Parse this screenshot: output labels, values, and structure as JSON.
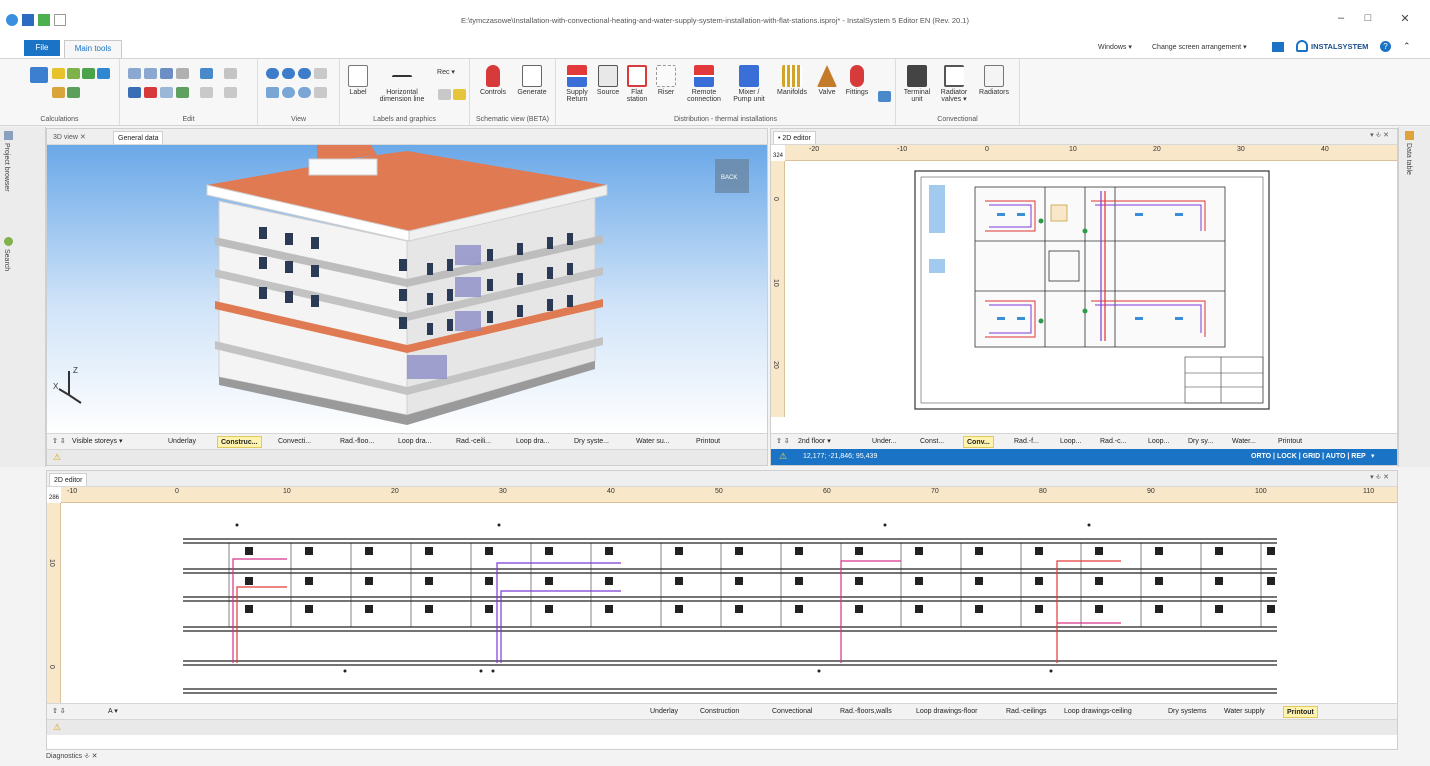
{
  "window": {
    "title": "E:\\tymczasowe\\Installation-with-convectional-heating-and-water-supply-system-installation-with-flat-stations.isproj* - InstalSystem 5 Editor EN (Rev. 20.1)"
  },
  "tabs": {
    "file": "File",
    "main_tools": "Main tools"
  },
  "top_right": {
    "windows": "Windows",
    "change_arrangement": "Change screen arrangement",
    "brand": "INSTALSYSTEM"
  },
  "ribbon": {
    "groups": {
      "calculations": "Calculations",
      "edit": "Edit",
      "view": "View",
      "labels_graphics": "Labels and graphics",
      "schematic": "Schematic view (BETA)",
      "distribution": "Distribution - thermal installations",
      "convectional": "Convectional"
    },
    "buttons": {
      "label": "Label",
      "horizontal_dim_1": "Horizontal",
      "horizontal_dim_2": "dimension line",
      "rec": "Rec",
      "controls": "Controls",
      "generate": "Generate",
      "supply_return_1": "Supply",
      "supply_return_2": "Return",
      "source": "Source",
      "flat_station_1": "Flat",
      "flat_station_2": "station",
      "riser": "Riser",
      "remote_1": "Remote",
      "remote_2": "connection",
      "mixer_1": "Mixer /",
      "mixer_2": "Pump unit",
      "manifolds": "Manifolds",
      "valve": "Valve",
      "fittings": "Fittings",
      "terminal_1": "Terminal",
      "terminal_2": "unit",
      "radiator_valves_1": "Radiator",
      "radiator_valves_2": "valves",
      "radiators": "Radiators"
    }
  },
  "side": {
    "project_browser": "Project browser",
    "search": "Search",
    "data_table": "Data table"
  },
  "view3d": {
    "tab_3d": "3D view",
    "tab_general": "General data",
    "layers": [
      "Visible storeys",
      "Underlay",
      "Construc...",
      "Convecti...",
      "Rad.-floo...",
      "Loop dra...",
      "Rad.-ceili...",
      "Loop dra...",
      "Dry syste...",
      "Water su...",
      "Printout"
    ],
    "cube_label": "BACK"
  },
  "editor_top": {
    "tab": "• 2D editor",
    "ruler_corner": "324",
    "ruler_x": [
      "-20",
      "-10",
      "0",
      "10",
      "20",
      "30",
      "40"
    ],
    "ruler_y": [
      "0",
      "10",
      "20"
    ],
    "floor": "2nd floor",
    "layers": [
      "Under...",
      "Const...",
      "Conv...",
      "Rad.-f...",
      "Loop...",
      "Rad.-c...",
      "Loop...",
      "Dry sy...",
      "Water...",
      "Printout"
    ],
    "coords": "12,177; -21,846; 95,439",
    "modes": "ORTO | LOCK | GRID | AUTO | REP"
  },
  "editor_bottom": {
    "tab": "2D editor",
    "ruler_corner": "286",
    "ruler_x": [
      "-10",
      "0",
      "10",
      "20",
      "30",
      "40",
      "50",
      "60",
      "70",
      "80",
      "90",
      "100",
      "110"
    ],
    "ruler_y": [
      "10",
      "0"
    ],
    "section": "A",
    "layers": [
      "Underlay",
      "Construction",
      "Convectional",
      "Rad.-floors,walls",
      "Loop drawings-floor",
      "Rad.-ceilings",
      "Loop drawings-ceiling",
      "Dry systems",
      "Water supply",
      "Printout"
    ]
  },
  "diagnostics": "Diagnostics",
  "colors": {
    "accent": "#1a73c4",
    "ruler": "#f8e7c9",
    "roof": "#e07a53",
    "supply": "#e23a3a",
    "return": "#7a3ad8",
    "highlight": "#fff3b0"
  }
}
